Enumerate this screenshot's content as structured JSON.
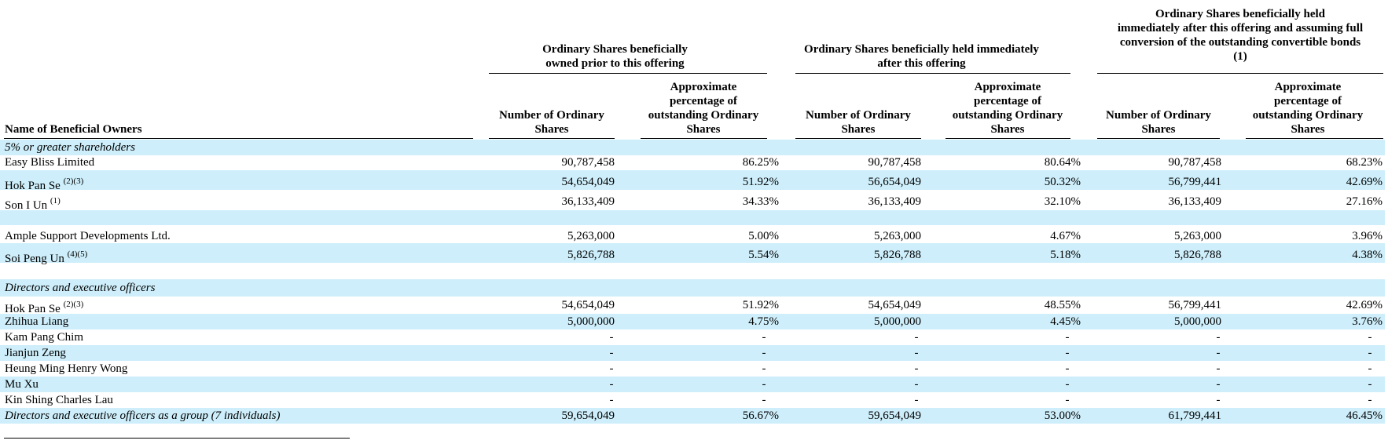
{
  "header": {
    "name_column": "Name of Beneficial Owners",
    "groups": [
      {
        "title_lines": [
          "Ordinary Shares beneficially",
          "owned prior to this offering"
        ],
        "number_header": [
          "Number of Ordinary",
          "Shares"
        ],
        "percent_header": [
          "Approximate",
          "percentage of",
          "outstanding Ordinary",
          "Shares"
        ]
      },
      {
        "title_lines": [
          "Ordinary Shares beneficially held immediately",
          "after this offering"
        ],
        "number_header": [
          "Number of Ordinary",
          "Shares"
        ],
        "percent_header": [
          "Approximate",
          "percentage of",
          "outstanding Ordinary",
          "Shares"
        ]
      },
      {
        "title_lines": [
          "Ordinary Shares beneficially held",
          "immediately after this offering and assuming full",
          "conversion of the outstanding convertible bonds",
          "(1)"
        ],
        "number_header": [
          "Number of Ordinary",
          "Shares"
        ],
        "percent_header": [
          "Approximate",
          "percentage of",
          "outstanding Ordinary",
          "Shares"
        ]
      }
    ]
  },
  "rows": [
    {
      "kind": "section",
      "label": "5% or greater shareholders",
      "band": true
    },
    {
      "kind": "data",
      "label": "Easy Bliss Limited",
      "sup": "",
      "band": false,
      "values": [
        "90,787,458",
        "86.25%",
        "90,787,458",
        "80.64%",
        "90,787,458",
        "68.23%"
      ]
    },
    {
      "kind": "data",
      "label": "Hok Pan Se",
      "sup": "(2)(3)",
      "band": true,
      "values": [
        "54,654,049",
        "51.92%",
        "56,654,049",
        "50.32%",
        "56,799,441",
        "42.69%"
      ]
    },
    {
      "kind": "data",
      "label": "Son I Un",
      "sup": "(1)",
      "band": false,
      "values": [
        "36,133,409",
        "34.33%",
        "36,133,409",
        "32.10%",
        "36,133,409",
        "27.16%"
      ]
    },
    {
      "kind": "spacer",
      "band": true
    },
    {
      "kind": "data",
      "label": "Ample Support Developments Ltd.",
      "sup": "",
      "band": false,
      "values": [
        "5,263,000",
        "5.00%",
        "5,263,000",
        "4.67%",
        "5,263,000",
        "3.96%"
      ]
    },
    {
      "kind": "data",
      "label": "Soi Peng Un",
      "sup": "(4)(5)",
      "band": true,
      "values": [
        "5,826,788",
        "5.54%",
        "5,826,788",
        "5.18%",
        "5,826,788",
        "4.38%"
      ]
    },
    {
      "kind": "spacer",
      "band": false
    },
    {
      "kind": "section",
      "label": "Directors and executive officers",
      "band": true
    },
    {
      "kind": "data",
      "label": "Hok Pan Se",
      "sup": "(2)(3)",
      "band": false,
      "values": [
        "54,654,049",
        "51.92%",
        "54,654,049",
        "48.55%",
        "56,799,441",
        "42.69%"
      ]
    },
    {
      "kind": "data",
      "label": "Zhihua Liang",
      "sup": "",
      "band": true,
      "values": [
        "5,000,000",
        "4.75%",
        "5,000,000",
        "4.45%",
        "5,000,000",
        "3.76%"
      ]
    },
    {
      "kind": "data",
      "label": "Kam Pang Chim",
      "sup": "",
      "band": false,
      "values": [
        "-",
        "-",
        "-",
        "-",
        "-",
        "-"
      ]
    },
    {
      "kind": "data",
      "label": "Jianjun Zeng",
      "sup": "",
      "band": true,
      "values": [
        "-",
        "-",
        "-",
        "-",
        "-",
        "-"
      ]
    },
    {
      "kind": "data",
      "label": "Heung Ming Henry Wong",
      "sup": "",
      "band": false,
      "values": [
        "-",
        "-",
        "-",
        "-",
        "-",
        "-"
      ]
    },
    {
      "kind": "data",
      "label": "Mu Xu",
      "sup": "",
      "band": true,
      "values": [
        "-",
        "-",
        "-",
        "-",
        "-",
        "-"
      ]
    },
    {
      "kind": "data",
      "label": "Kin Shing Charles Lau",
      "sup": "",
      "band": false,
      "values": [
        "-",
        "-",
        "-",
        "-",
        "-",
        "-"
      ]
    },
    {
      "kind": "data",
      "label": "Directors and executive officers as a group (7 individuals)",
      "sup": "",
      "band": true,
      "italic": true,
      "values": [
        "59,654,049",
        "56.67%",
        "59,654,049",
        "53.00%",
        "61,799,441",
        "46.45%"
      ]
    }
  ]
}
